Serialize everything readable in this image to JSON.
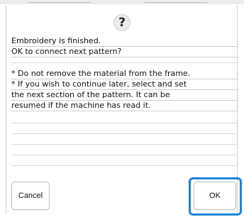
{
  "dialog": {
    "icon": "question-icon",
    "icon_glyph": "?",
    "message_lines": [
      "Embroidery is finished.",
      "OK to connect next pattern?"
    ],
    "note_lines": [
      "* Do not remove the material from the frame.",
      "* If you wish to continue later, select and set",
      "the next section of the pattern. It can be",
      "resumed if the machine has read it."
    ]
  },
  "buttons": {
    "cancel_label": "Cancel",
    "ok_label": "OK"
  },
  "colors": {
    "highlight": "#1d84d8",
    "background": "#ffffff",
    "text": "#111111"
  }
}
